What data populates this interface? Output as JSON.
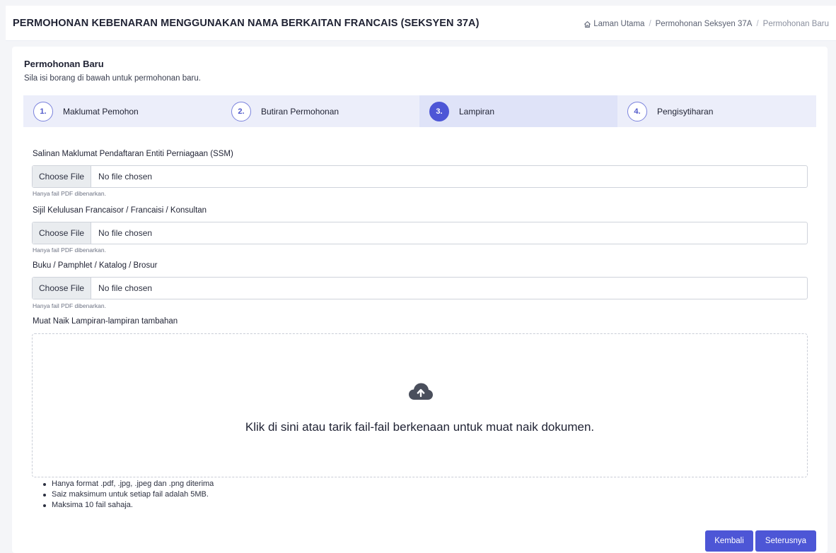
{
  "header": {
    "title": "PERMOHONAN KEBENARAN MENGGUNAKAN NAMA BERKAITAN FRANCAIS (SEKSYEN 37A)",
    "breadcrumb": [
      "Laman Utama",
      "Permohonan Seksyen 37A",
      "Permohonan Baru"
    ],
    "home_icon": "home-icon"
  },
  "card": {
    "title": "Permohonan Baru",
    "subtitle": "Sila isi borang di bawah untuk permohonan baru."
  },
  "steps": [
    {
      "num": "1.",
      "label": "Maklumat Pemohon",
      "active": false
    },
    {
      "num": "2.",
      "label": "Butiran Permohonan",
      "active": false
    },
    {
      "num": "3.",
      "label": "Lampiran",
      "active": true
    },
    {
      "num": "4.",
      "label": "Pengisytiharan",
      "active": false
    }
  ],
  "fields": [
    {
      "label": "Salinan Maklumat Pendaftaran Entiti Perniagaan (SSM)",
      "button": "Choose File",
      "status": "No file chosen",
      "help": "Hanya fail PDF dibenarkan."
    },
    {
      "label": "Sijil Kelulusan Francaisor / Francaisi / Konsultan",
      "button": "Choose File",
      "status": "No file chosen",
      "help": "Hanya fail PDF dibenarkan."
    },
    {
      "label": "Buku / Pamphlet / Katalog / Brosur",
      "button": "Choose File",
      "status": "No file chosen",
      "help": "Hanya fail PDF dibenarkan."
    }
  ],
  "dropzone": {
    "label": "Muat Naik Lampiran-lampiran tambahan",
    "text": "Klik di sini atau tarik fail-fail berkenaan untuk muat naik dokumen.",
    "icon": "cloud-upload-icon"
  },
  "notes": [
    "Hanya format .pdf, .jpg, .jpeg dan .png diterima",
    "Saiz maksimum untuk setiap fail adalah 5MB.",
    "Maksima 10 fail sahaja."
  ],
  "buttons": {
    "back": "Kembali",
    "next": "Seterusnya"
  },
  "colors": {
    "accent": "#4d56d6",
    "step_bar": "#eceefa"
  }
}
